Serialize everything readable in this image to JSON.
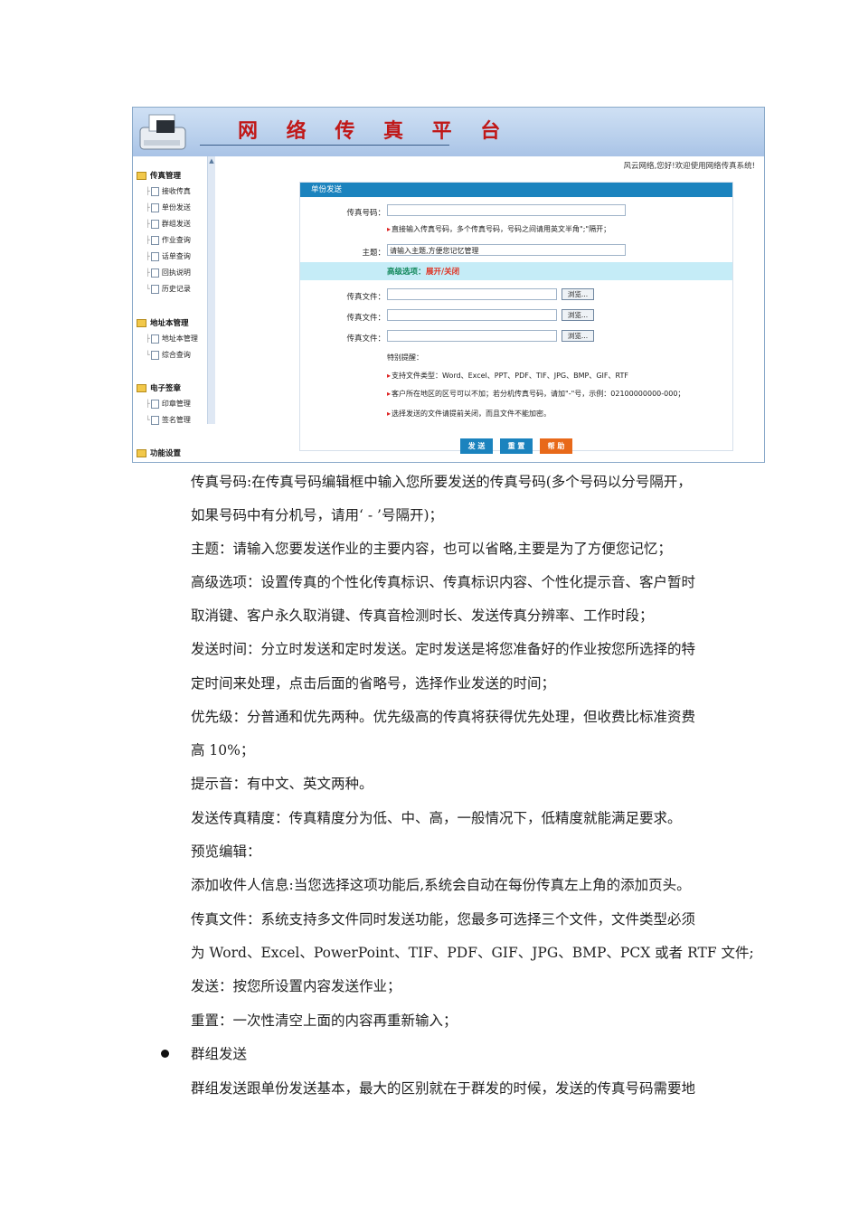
{
  "screenshot": {
    "banner_title": "网 络 传 真 平 台",
    "welcome": "风云网络,您好!欢迎使用网络传真系统!",
    "sidebar": {
      "groups": [
        {
          "label": "传真管理",
          "items": [
            "接收传真",
            "单份发送",
            "群组发送",
            "作业查询",
            "话单查询",
            "回执说明",
            "历史记录"
          ]
        },
        {
          "label": "地址本管理",
          "items": [
            "地址本管理",
            "综合查询"
          ]
        },
        {
          "label": "电子签章",
          "items": [
            "印章管理",
            "签名管理"
          ]
        },
        {
          "label": "功能设置",
          "items": []
        }
      ]
    },
    "panel": {
      "heading": "单份发送",
      "fax_number_label": "传真号码：",
      "fax_number_value": "",
      "fax_hint": "直接输入传真号码，多个传真号码，号码之间请用英文半角\";\"隔开；",
      "subject_label": "主题：",
      "subject_value": "请输入主题,方便您记忆管理",
      "advanced_label": "高级选项：",
      "advanced_toggle": "展开/关闭",
      "file_label": "传真文件：",
      "browse_label": "浏览...",
      "notes_title": "特别提醒：",
      "notes": [
        "支持文件类型：Word、Excel、PPT、PDF、TIF、JPG、BMP、GIF、RTF",
        "客户所在地区的区号可以不加；若分机传真号码，请加\"-\"号，示例：02100000000-000；",
        "选择发送的文件请提前关闭，而且文件不能加密。"
      ],
      "buttons": [
        "发 送",
        "重 置",
        "帮 助"
      ]
    }
  },
  "document": {
    "lines": [
      "传真号码:在传真号码编辑框中输入您所要发送的传真号码(多个号码以分号隔开，",
      "如果号码中有分机号，请用‘ - ’号隔开)；",
      "主题：请输入您要发送作业的主要内容，也可以省略,主要是为了方便您记忆；",
      "高级选项：设置传真的个性化传真标识、传真标识内容、个性化提示音、客户暂时",
      "取消键、客户永久取消键、传真音检测时长、发送传真分辨率、工作时段；",
      "发送时间：分立时发送和定时发送。定时发送是将您准备好的作业按您所选择的特",
      "定时间来处理，点击后面的省略号，选择作业发送的时间；",
      "优先级：分普通和优先两种。优先级高的传真将获得优先处理，但收费比标准资费",
      "高 10%；",
      "提示音：有中文、英文两种。",
      "发送传真精度：传真精度分为低、中、高，一般情况下，低精度就能满足要求。",
      "预览编辑：",
      "添加收件人信息:当您选择这项功能后,系统会自动在每份传真左上角的添加页头。",
      "传真文件：系统支持多文件同时发送功能，您最多可选择三个文件，文件类型必须",
      "为 Word、Excel、PowerPoint、TIF、PDF、GIF、JPG、BMP、PCX 或者 RTF 文件;",
      "发送：按您所设置内容发送作业；",
      "重置：一次性清空上面的内容再重新输入；"
    ],
    "bullet_heading": "群组发送",
    "bullet_text": "群组发送跟单份发送基本，最大的区别就在于群发的时候，发送的传真号码需要地"
  }
}
